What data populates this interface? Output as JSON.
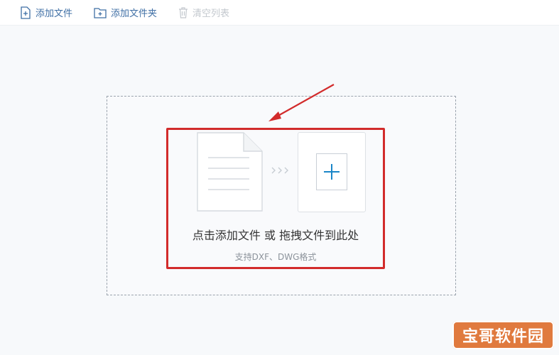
{
  "toolbar": {
    "add_file_label": "添加文件",
    "add_folder_label": "添加文件夹",
    "clear_list_label": "清空列表"
  },
  "dropzone": {
    "main_text": "点击添加文件 或 拖拽文件到此处",
    "sub_text": "支持DXF、DWG格式"
  },
  "watermark": {
    "text": "宝哥软件园"
  },
  "colors": {
    "accent": "#3f6fa5",
    "highlight_border": "#d22b2b",
    "plus": "#1a86c8",
    "watermark_bg": "#e07a3e"
  }
}
